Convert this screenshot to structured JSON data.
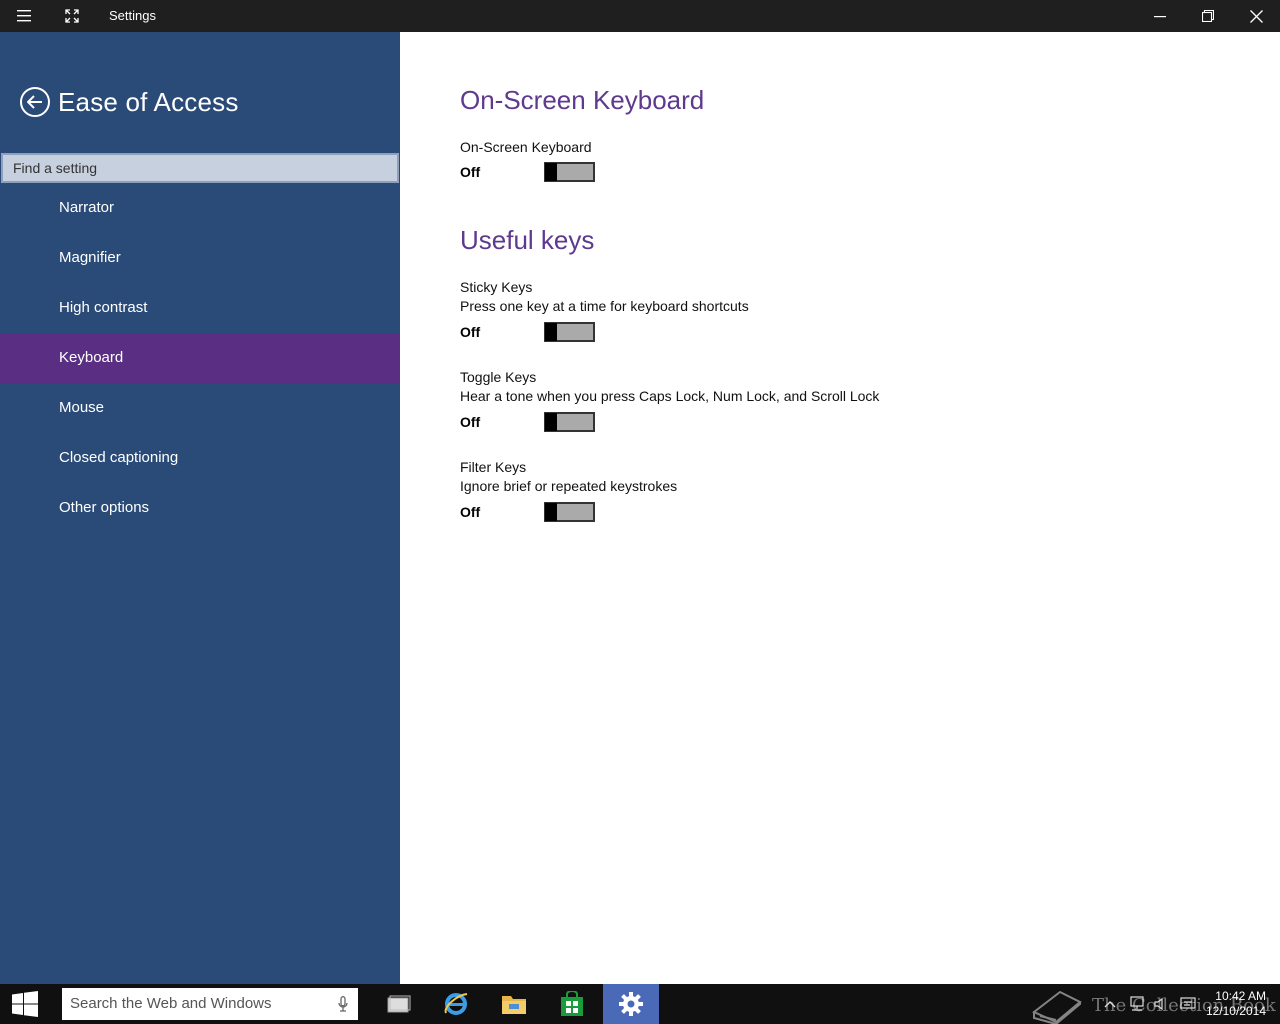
{
  "window": {
    "title": "Settings"
  },
  "sidebar": {
    "title": "Ease of Access",
    "search_placeholder": "Find a setting",
    "items": [
      {
        "label": "Narrator"
      },
      {
        "label": "Magnifier"
      },
      {
        "label": "High contrast"
      },
      {
        "label": "Keyboard"
      },
      {
        "label": "Mouse"
      },
      {
        "label": "Closed captioning"
      },
      {
        "label": "Other options"
      }
    ],
    "active_item": "Keyboard"
  },
  "main": {
    "onscreen": {
      "heading": "On-Screen Keyboard",
      "label": "On-Screen Keyboard",
      "state": "Off"
    },
    "useful_keys": {
      "heading": "Useful keys",
      "sticky": {
        "label": "Sticky Keys",
        "desc": "Press one key at a time for keyboard shortcuts",
        "state": "Off"
      },
      "toggle": {
        "label": "Toggle Keys",
        "desc": "Hear a tone when you press Caps Lock, Num Lock, and Scroll Lock",
        "state": "Off"
      },
      "filter": {
        "label": "Filter Keys",
        "desc": "Ignore brief or repeated keystrokes",
        "state": "Off"
      }
    }
  },
  "taskbar": {
    "search_placeholder": "Search the Web and Windows",
    "time": "10:42 AM",
    "date": "12/10/2014",
    "watermark": "The Collection Book"
  },
  "colors": {
    "sidebar_bg": "#2a4b78",
    "active_item": "#5a2e82",
    "heading": "#5d3a8e",
    "titlebar": "#1f1f1f",
    "taskbar": "#101010"
  }
}
